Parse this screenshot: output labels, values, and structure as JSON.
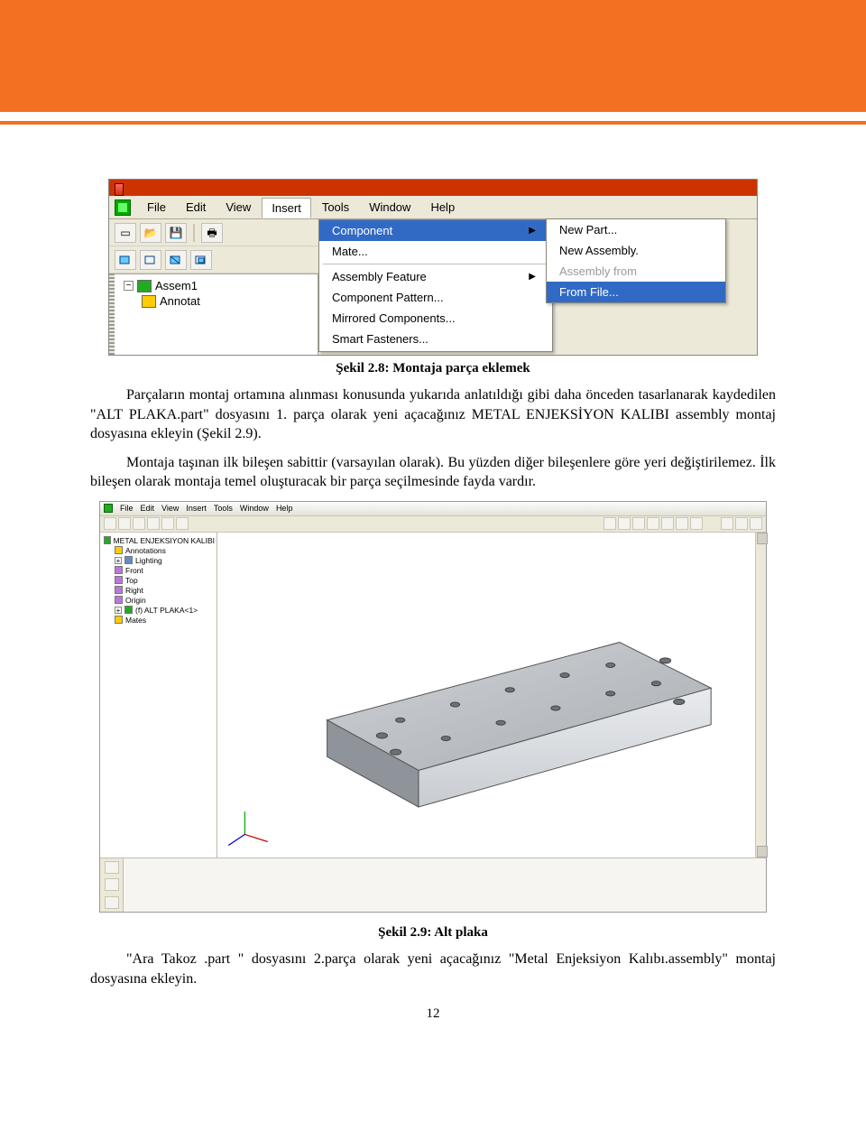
{
  "banner": {},
  "figure28": {
    "caption": "Şekil 2.8: Montaja parça eklemek",
    "menubar": [
      "File",
      "Edit",
      "View",
      "Insert",
      "Tools",
      "Window",
      "Help"
    ],
    "open_menu_index": 3,
    "tree": {
      "root": "Assem1",
      "child": "Annotat"
    },
    "dropdown": {
      "items": [
        {
          "label": "Component",
          "has_sub": true,
          "hover": true
        },
        {
          "label": "Mate...",
          "has_sub": false
        },
        {
          "sep": true
        },
        {
          "label": "Assembly Feature",
          "has_sub": true
        },
        {
          "label": "Component Pattern...",
          "has_sub": false
        },
        {
          "label": "Mirrored Components...",
          "has_sub": false
        },
        {
          "label": "Smart Fasteners...",
          "has_sub": false
        }
      ]
    },
    "submenu": {
      "items": [
        {
          "label": "New Part..."
        },
        {
          "label": "New Assembly."
        },
        {
          "label": "Assembly from",
          "disabled": true
        },
        {
          "label": "From File...",
          "hover": true
        }
      ]
    }
  },
  "para1": "Parçaların montaj ortamına alınması konusunda yukarıda anlatıldığı gibi daha önceden tasarlanarak kaydedilen \"ALT PLAKA.part\" dosyasını 1. parça olarak yeni açacağınız METAL ENJEKSİYON KALIBI assembly montaj dosyasına ekleyin (Şekil 2.9).",
  "para2": "Montaja taşınan ilk bileşen sabittir (varsayılan olarak). Bu yüzden diğer bileşenlere göre yeri değiştirilemez. İlk bileşen olarak montaja temel oluşturacak bir parça seçilmesinde fayda vardır.",
  "figure29": {
    "caption": "Şekil 2.9: Alt plaka",
    "menubar": [
      "File",
      "Edit",
      "View",
      "Insert",
      "Tools",
      "Window",
      "Help"
    ],
    "tree": {
      "root": "METAL ENJEKSIYON KALIBI",
      "items": [
        {
          "icon": "y",
          "label": "Annotations"
        },
        {
          "icon": "b",
          "label": "Lighting",
          "pm": "+"
        },
        {
          "icon": "p",
          "label": "Front"
        },
        {
          "icon": "p",
          "label": "Top"
        },
        {
          "icon": "p",
          "label": "Right"
        },
        {
          "icon": "p",
          "label": "Origin"
        },
        {
          "icon": "g",
          "label": "(f) ALT PLAKA<1>",
          "pm": "+"
        },
        {
          "icon": "y",
          "label": "Mates"
        }
      ]
    }
  },
  "para3": "\"Ara Takoz .part \" dosyasını 2.parça olarak yeni açacağınız \"Metal Enjeksiyon Kalıbı.assembly\" montaj dosyasına ekleyin.",
  "page_number": "12"
}
